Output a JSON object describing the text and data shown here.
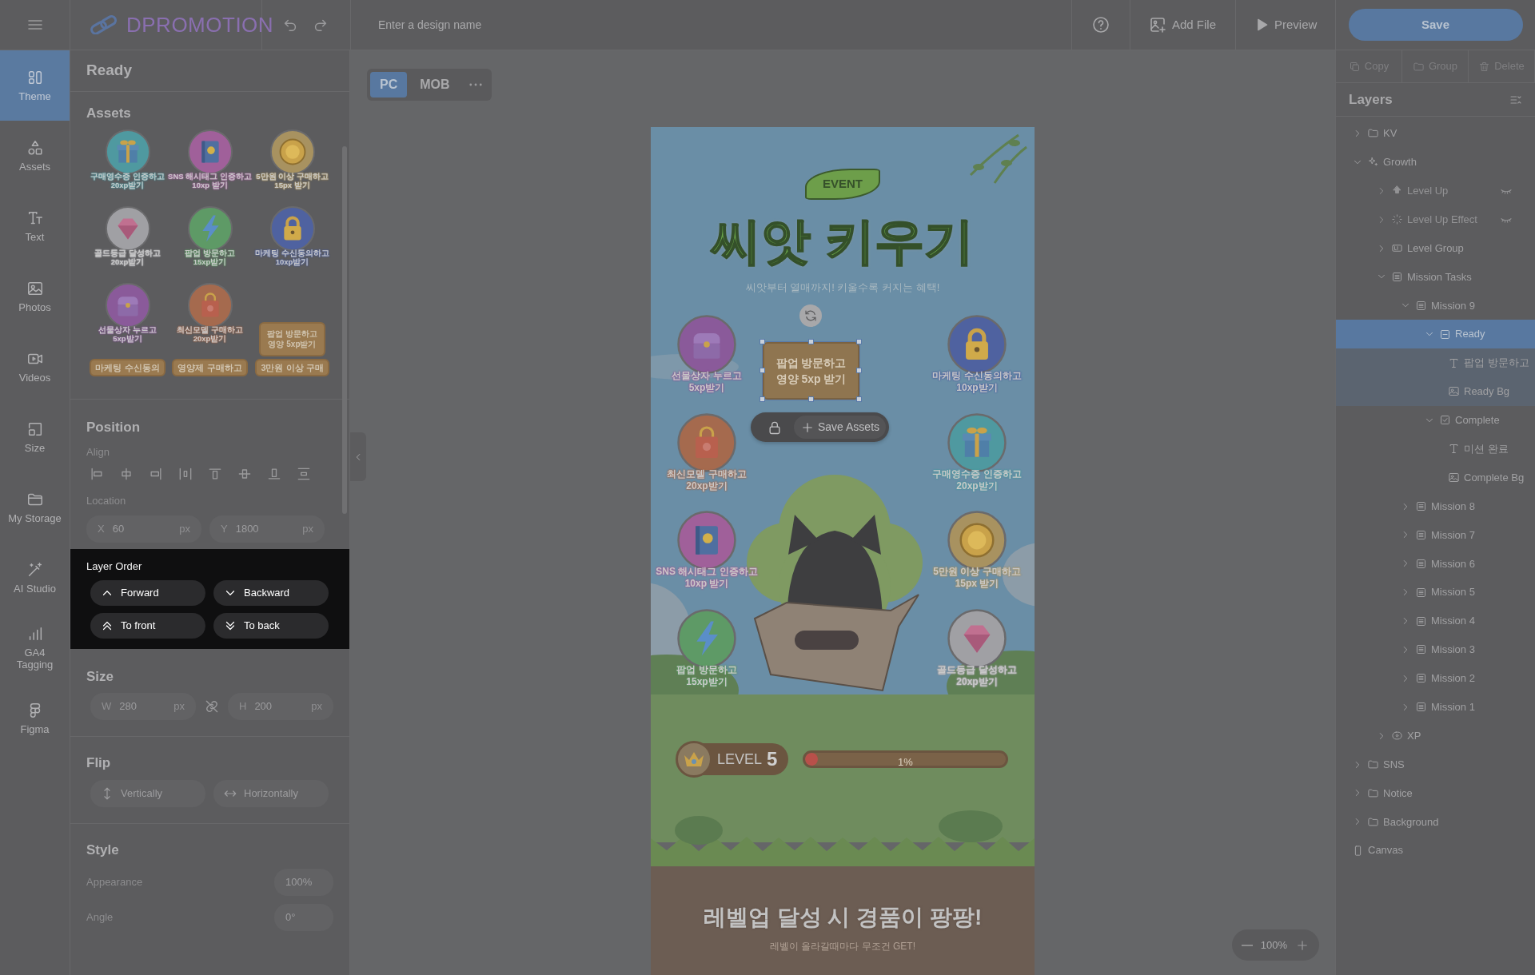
{
  "app_bar": {
    "brand": "DPROMOTION",
    "design_name_placeholder": "Enter a design name",
    "add_file": "Add File",
    "preview": "Preview",
    "save": "Save"
  },
  "rail": [
    {
      "kind": "theme",
      "label": "Theme",
      "selected": true
    },
    {
      "kind": "assets",
      "label": "Assets",
      "selected": false
    },
    {
      "kind": "text",
      "label": "Text",
      "selected": false
    },
    {
      "kind": "photos",
      "label": "Photos",
      "selected": false
    },
    {
      "kind": "videos",
      "label": "Videos",
      "selected": false
    },
    {
      "kind": "size",
      "label": "Size",
      "selected": false
    },
    {
      "kind": "storage",
      "label": "My Storage",
      "selected": false
    },
    {
      "kind": "ai",
      "label": "AI Studio",
      "selected": false
    },
    {
      "kind": "chart",
      "label": "GA4 Tagging",
      "selected": false
    },
    {
      "kind": "figma",
      "label": "Figma",
      "selected": false
    }
  ],
  "panel": {
    "title": "Ready",
    "assets_title": "Assets",
    "assets": [
      {
        "kind": "gift",
        "color": "#4f99a0",
        "lines": [
          "구매영수증 인증하고",
          "20xp받기"
        ]
      },
      {
        "kind": "book",
        "color": "#a0609a",
        "lines": [
          "SNS 해시태그 인증하고",
          "10xp 받기"
        ]
      },
      {
        "kind": "coin",
        "color": "#a89260",
        "lines": [
          "5만원 이상 구매하고",
          "15px 받기"
        ]
      },
      {
        "kind": "gem",
        "color": "#a0a0a4",
        "lines": [
          "골드등급 달성하고",
          "20xp받기"
        ]
      },
      {
        "kind": "bolt",
        "color": "#5e9a66",
        "lines": [
          "팝업 방문하고",
          "15xp받기"
        ]
      },
      {
        "kind": "lock",
        "color": "#4f62a0",
        "lines": [
          "마케팅 수신동의하고",
          "10xp받기"
        ]
      },
      {
        "kind": "chest",
        "color": "#8a5a9a",
        "lines": [
          "선물상자 누르고",
          "5xp받기"
        ]
      },
      {
        "kind": "bag",
        "color": "#a56a4e",
        "lines": [
          "최신모델 구매하고",
          "20xp받기"
        ]
      },
      {
        "kind": "tile",
        "lines": [
          "팝업 방문하고",
          "영양 5xp받기"
        ]
      },
      {
        "kind": "tile",
        "lines": [
          "마케팅 수신동의"
        ]
      },
      {
        "kind": "tile",
        "lines": [
          "영양제 구매하고"
        ]
      },
      {
        "kind": "tile",
        "lines": [
          "3만원 이상 구매"
        ]
      }
    ],
    "position": {
      "title": "Position",
      "align_label": "Align",
      "location_label": "Location",
      "x": {
        "label": "X",
        "value": "60",
        "unit": "px"
      },
      "y": {
        "label": "Y",
        "value": "1800",
        "unit": "px"
      }
    },
    "layer_order": {
      "title": "Layer Order",
      "buttons": [
        {
          "kind": "forward",
          "label": "Forward"
        },
        {
          "kind": "backward",
          "label": "Backward"
        },
        {
          "kind": "front",
          "label": "To front"
        },
        {
          "kind": "back",
          "label": "To back"
        }
      ]
    },
    "size": {
      "title": "Size",
      "w": {
        "label": "W",
        "value": "280",
        "unit": "px"
      },
      "h": {
        "label": "H",
        "value": "200",
        "unit": "px"
      }
    },
    "flip": {
      "title": "Flip",
      "buttons": [
        {
          "kind": "vertical",
          "label": "Vertically"
        },
        {
          "kind": "horizontal",
          "label": "Horizontally"
        }
      ]
    },
    "style": {
      "title": "Style",
      "rows": [
        {
          "label": "Appearance",
          "value": "100%"
        },
        {
          "label": "Angle",
          "value": "0°"
        }
      ]
    }
  },
  "devices": [
    {
      "label": "PC",
      "selected": true
    },
    {
      "label": "MOB",
      "selected": false
    }
  ],
  "design": {
    "event_tag": "EVENT",
    "title": "씨앗 키우기",
    "subtitle": "씨앗부터 열매까지! 키울수록 커지는 혜택!",
    "missions_left": [
      {
        "kind": "chest",
        "color": "#8a5a9a",
        "lines": [
          "선물상자 누르고",
          "5xp받기"
        ]
      },
      {
        "kind": "bag",
        "color": "#a56a4e",
        "lines": [
          "최신모델 구매하고",
          "20xp받기"
        ]
      },
      {
        "kind": "book",
        "color": "#a0609a",
        "lines": [
          "SNS 해시태그 인증하고",
          "10xp 받기"
        ]
      },
      {
        "kind": "bolt",
        "color": "#5e9a66",
        "lines": [
          "팝업 방문하고",
          "15xp받기"
        ]
      }
    ],
    "missions_right": [
      {
        "kind": "lock",
        "color": "#4f62a0",
        "lines": [
          "마케팅 수신동의하고",
          "10xp받기"
        ]
      },
      {
        "kind": "gift",
        "color": "#4f99a0",
        "lines": [
          "구매영수증 인증하고",
          "20xp받기"
        ]
      },
      {
        "kind": "coin",
        "color": "#a89260",
        "lines": [
          "5만원 이상 구매하고",
          "15px 받기"
        ]
      },
      {
        "kind": "gem",
        "color": "#a0a0a4",
        "lines": [
          "골드등급 달성하고",
          "20xp받기"
        ]
      }
    ],
    "selected_element": {
      "lines": [
        "팝업 방문하고",
        "영양 5xp 받기"
      ]
    },
    "element_toolbar": {
      "action": "Save Assets"
    },
    "level": {
      "label": "LEVEL",
      "number": "5"
    },
    "progress": {
      "level": 0.01,
      "reading": "1%"
    },
    "footer": {
      "headline": "**레벨업** 달성 시 경품이 팡팡!",
      "sub": "레벨이 올라갈때마다 무조건 GET!"
    }
  },
  "zoom": "100%",
  "layer_actions": [
    {
      "kind": "copy",
      "label": "Copy"
    },
    {
      "kind": "group",
      "label": "Group"
    },
    {
      "kind": "delete",
      "label": "Delete"
    }
  ],
  "layers_title": "Layers",
  "layers": [
    {
      "label": "KV",
      "kind": "folder",
      "expanded": false,
      "selected": false
    },
    {
      "label": "Growth",
      "kind": "sparkle",
      "expanded": true,
      "selected": false,
      "children": [
        {
          "label": "Level Up",
          "kind": "arrow",
          "expanded": false,
          "selected": false,
          "hidden": true
        },
        {
          "label": "Level Up Effect",
          "kind": "effect",
          "expanded": false,
          "selected": false,
          "hidden": true
        },
        {
          "label": "Level Group",
          "kind": "lv",
          "expanded": false,
          "selected": false,
          "hidden": false
        },
        {
          "label": "Mission Tasks",
          "kind": "list",
          "expanded": true,
          "selected": false,
          "hidden": false,
          "children": [
            {
              "label": "Mission 9",
              "kind": "list",
              "expanded": true,
              "selected": false,
              "children": [
                {
                  "label": "Ready",
                  "kind": "state",
                  "expanded": true,
                  "selected": true,
                  "children": [
                    {
                      "label": "팝업 방문하고",
                      "kind": "text",
                      "selected": false
                    },
                    {
                      "label": "Ready Bg",
                      "kind": "image",
                      "selected": false
                    }
                  ]
                },
                {
                  "label": "Complete",
                  "kind": "check",
                  "expanded": true,
                  "selected": false,
                  "children": [
                    {
                      "label": "미션 완료",
                      "kind": "text",
                      "selected": false
                    },
                    {
                      "label": "Complete Bg",
                      "kind": "image",
                      "selected": false
                    }
                  ]
                }
              ]
            },
            {
              "label": "Mission 8",
              "kind": "list",
              "expanded": false,
              "selected": false
            },
            {
              "label": "Mission 7",
              "kind": "list",
              "expanded": false,
              "selected": false
            },
            {
              "label": "Mission 6",
              "kind": "list",
              "expanded": false,
              "selected": false
            },
            {
              "label": "Mission 5",
              "kind": "list",
              "expanded": false,
              "selected": false
            },
            {
              "label": "Mission 4",
              "kind": "list",
              "expanded": false,
              "selected": false
            },
            {
              "label": "Mission 3",
              "kind": "list",
              "expanded": false,
              "selected": false
            },
            {
              "label": "Mission 2",
              "kind": "list",
              "expanded": false,
              "selected": false
            },
            {
              "label": "Mission 1",
              "kind": "list",
              "expanded": false,
              "selected": false
            }
          ]
        },
        {
          "label": "XP",
          "kind": "xp",
          "expanded": false,
          "selected": false,
          "hidden": false
        }
      ]
    },
    {
      "label": "SNS",
      "kind": "folder",
      "expanded": false,
      "selected": false
    },
    {
      "label": "Notice",
      "kind": "folder",
      "expanded": false,
      "selected": false
    },
    {
      "label": "Background",
      "kind": "folder",
      "expanded": false,
      "selected": false
    },
    {
      "label": "Canvas",
      "kind": "canvas",
      "selected": false
    }
  ]
}
